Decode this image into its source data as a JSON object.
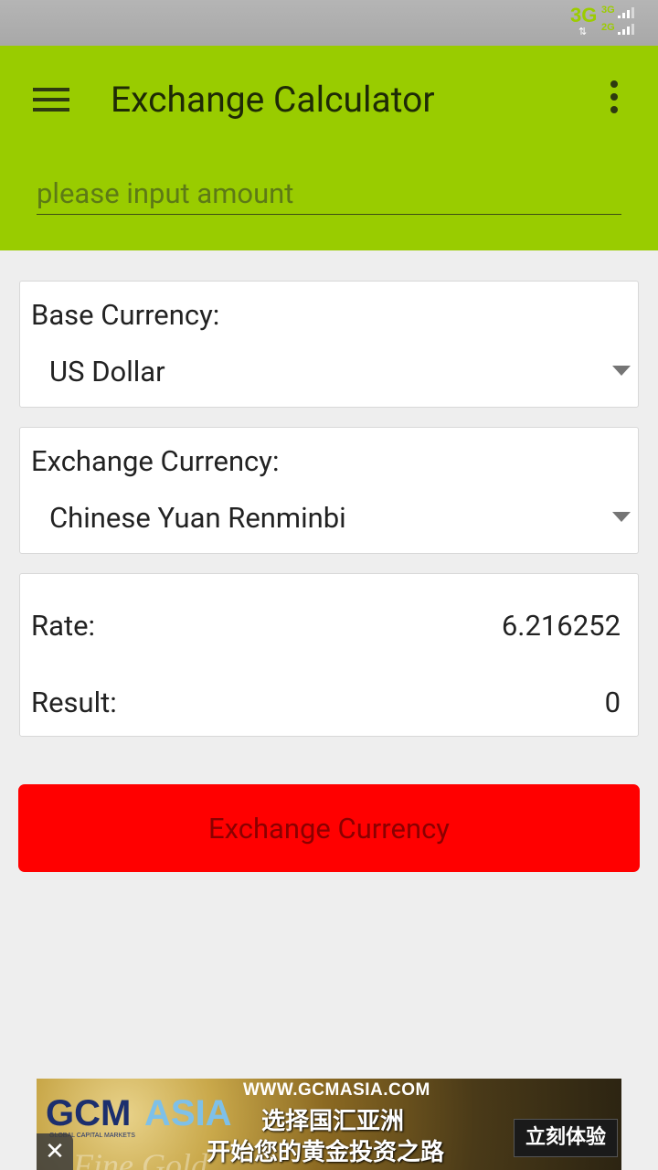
{
  "status_bar": {
    "network_primary": "3G",
    "network_sim1": "3G",
    "network_sim2": "2G",
    "data_arrows": "⇅"
  },
  "app_bar": {
    "title": "Exchange Calculator",
    "menu_icon": "hamburger-menu-icon",
    "overflow_icon": "more-vertical-icon",
    "background_color": "#99cc00"
  },
  "amount_input": {
    "value": "",
    "placeholder": "please input amount"
  },
  "base_currency": {
    "label": "Base Currency:",
    "selected": "US Dollar"
  },
  "exchange_currency": {
    "label": "Exchange Currency:",
    "selected": "Chinese Yuan Renminbi"
  },
  "results": {
    "rate_label": "Rate:",
    "rate_value": "6.216252",
    "result_label": "Result:",
    "result_value": "0"
  },
  "exchange_button": {
    "label": "Exchange Currency",
    "color": "#ff0000"
  },
  "ad": {
    "url": "WWW.GCMASIA.COM",
    "logo_part1": "GCM",
    "logo_part2": "ASIA",
    "tagline": "GLOBAL CAPITAL MARKETS",
    "line1": "选择国汇亚洲",
    "line2": "开始您的黄金投资之路",
    "cta": "立刻体验",
    "watermark": "Fine Gold",
    "close_symbol": "✕"
  }
}
